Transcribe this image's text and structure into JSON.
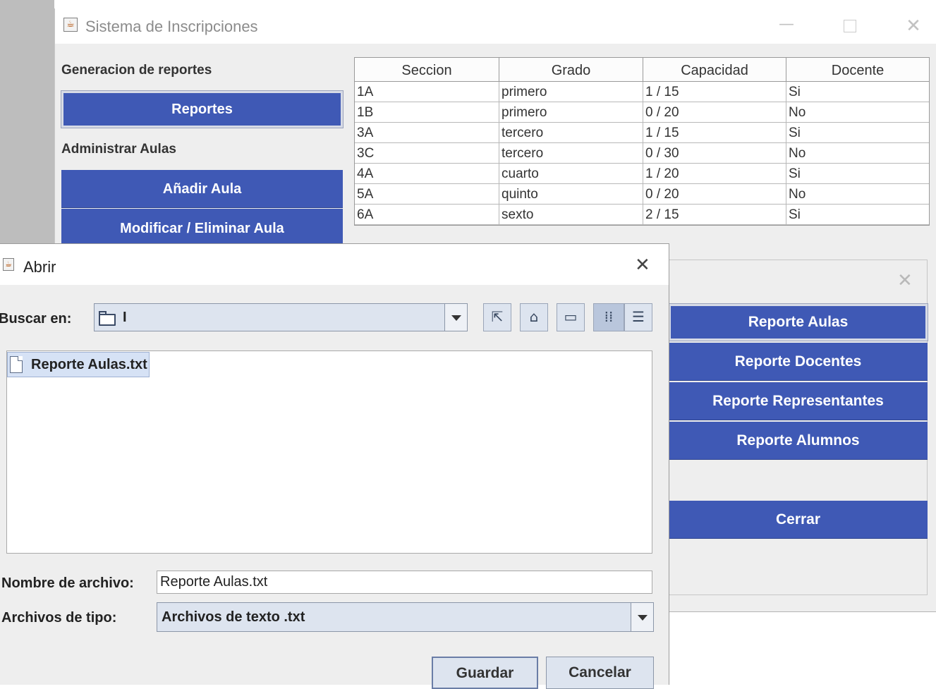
{
  "main_window": {
    "title": "Sistema de Inscripciones",
    "controls": {
      "minimize": "—",
      "maximize": "",
      "close": "✕"
    },
    "reports_heading": "Generacion de reportes",
    "reports_button": "Reportes",
    "aulas_heading": "Administrar Aulas",
    "add_aula_button": "Añadir Aula",
    "modify_aula_button": "Modificar / Eliminar Aula",
    "table": {
      "columns": [
        "Seccion",
        "Grado",
        "Capacidad",
        "Docente"
      ],
      "rows": [
        [
          "1A",
          "primero",
          "1 / 15",
          "Si"
        ],
        [
          "1B",
          "primero",
          "0 / 20",
          "No"
        ],
        [
          "3A",
          "tercero",
          "1 / 15",
          "Si"
        ],
        [
          "3C",
          "tercero",
          "0 / 30",
          "No"
        ],
        [
          "4A",
          "cuarto",
          "1 / 20",
          "Si"
        ],
        [
          "5A",
          "quinto",
          "0 / 20",
          "No"
        ],
        [
          "6A",
          "sexto",
          "2 / 15",
          "Si"
        ]
      ]
    }
  },
  "reports_panel": {
    "close": "✕",
    "buttons": [
      "Reporte Aulas",
      "Reporte Docentes",
      "Reporte Representantes",
      "Reporte Alumnos"
    ],
    "close_button": "Cerrar"
  },
  "open_dialog": {
    "title": "Abrir",
    "close": "✕",
    "look_in_label": "Buscar en:",
    "look_in_value": "I",
    "files": [
      "Reporte Aulas.txt"
    ],
    "filename_label": "Nombre de archivo:",
    "filename_value": "Reporte Aulas.txt",
    "filetype_label": "Archivos de tipo:",
    "filetype_value": "Archivos de texto .txt",
    "save_button": "Guardar",
    "cancel_button": "Cancelar"
  }
}
